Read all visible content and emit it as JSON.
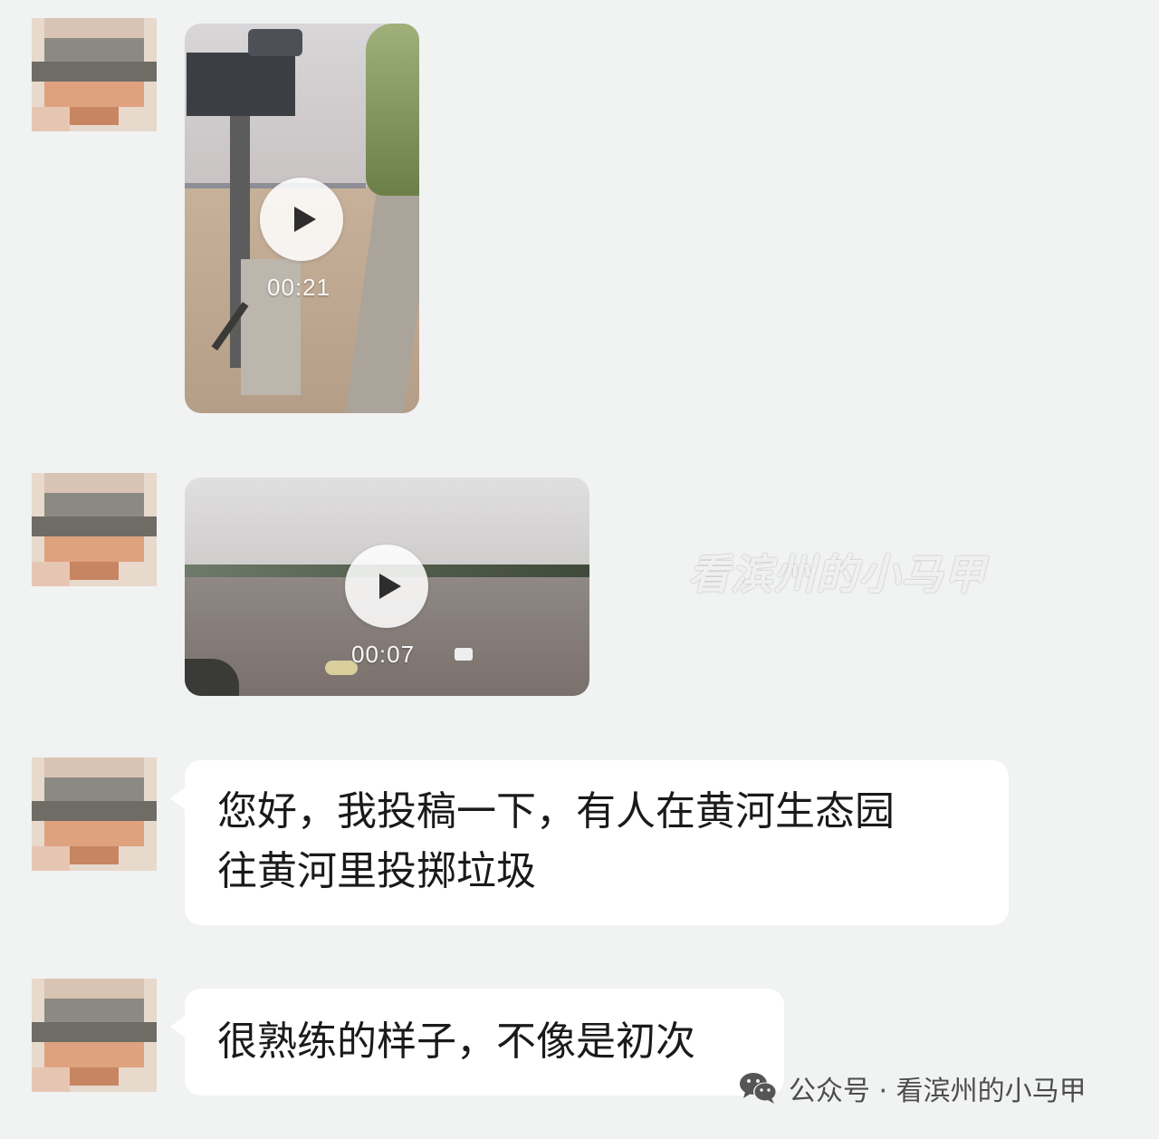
{
  "messages": [
    {
      "type": "video",
      "duration": "00:21"
    },
    {
      "type": "video",
      "duration": "00:07"
    },
    {
      "type": "text",
      "lines": [
        "您好，我投稿一下，有人在黄河生态园",
        "往黄河里投掷垃圾"
      ]
    },
    {
      "type": "text",
      "lines": [
        "很熟练的样子，不像是初次"
      ]
    }
  ],
  "watermark": "看滨州的小马甲",
  "footer": {
    "label": "公众号 · 看滨州的小马甲",
    "icon": "wechat-icon"
  },
  "colors": {
    "background": "#f1f2f2",
    "bubble": "#ffffff",
    "text": "#1a1a1a"
  }
}
